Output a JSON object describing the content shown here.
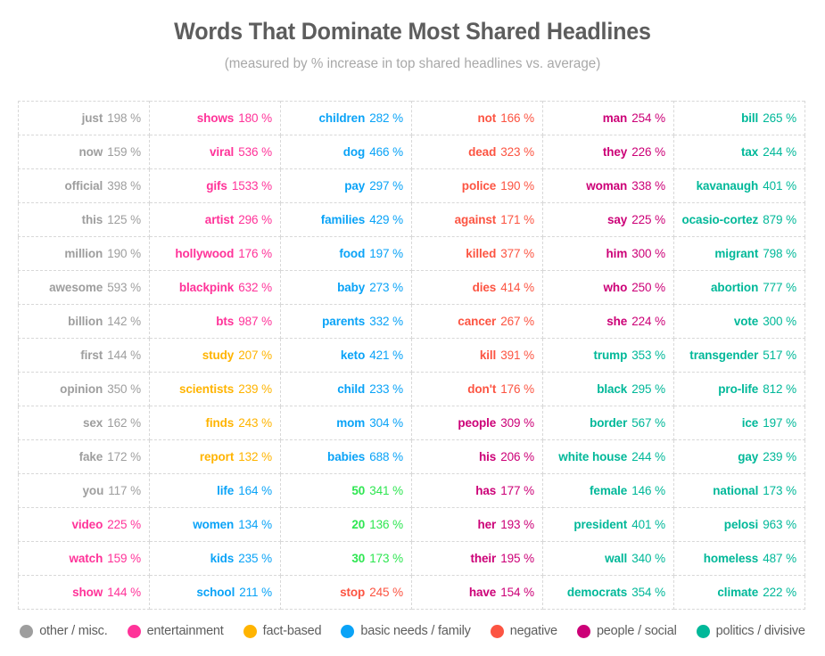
{
  "header": {
    "title": "Words That Dominate Most Shared Headlines",
    "subtitle": "(measured by % increase in top shared headlines vs. average)"
  },
  "unit_suffix": "%",
  "colors": {
    "other": "#9e9e9e",
    "entertainment": "#ff3399",
    "fact_based": "#ffb400",
    "basic_needs": "#0aa3f7",
    "negative": "#fc5442",
    "people_social": "#cc0077",
    "politics": "#00b899",
    "numbers": "#2ee651",
    "title": "#5d5d5d",
    "subtitle": "#a8a8a8",
    "grid_line": "#d8d8d8"
  },
  "legend": {
    "items": [
      {
        "label": "other / misc.",
        "color": "#9e9e9e",
        "key": "other"
      },
      {
        "label": "entertainment",
        "color": "#ff3399",
        "key": "entertainment"
      },
      {
        "label": "fact-based",
        "color": "#ffb400",
        "key": "fact_based"
      },
      {
        "label": "basic needs / family",
        "color": "#0aa3f7",
        "key": "basic_needs"
      },
      {
        "label": "negative",
        "color": "#fc5442",
        "key": "negative"
      },
      {
        "label": "people / social",
        "color": "#cc0077",
        "key": "people_social"
      },
      {
        "label": "politics / divisive",
        "color": "#00b899",
        "key": "politics"
      }
    ]
  },
  "chart_data": {
    "type": "table",
    "title": "Words That Dominate Most Shared Headlines",
    "subtitle": "(measured by % increase in top shared headlines vs. average)",
    "value_unit": "%",
    "columns": 6,
    "rows": 15,
    "grid": [
      [
        {
          "word": "just",
          "value": 198,
          "color": "#9e9e9e"
        },
        {
          "word": "shows",
          "value": 180,
          "color": "#ff3399"
        },
        {
          "word": "children",
          "value": 282,
          "color": "#0aa3f7"
        },
        {
          "word": "not",
          "value": 166,
          "color": "#fc5442"
        },
        {
          "word": "man",
          "value": 254,
          "color": "#cc0077"
        },
        {
          "word": "bill",
          "value": 265,
          "color": "#00b899"
        }
      ],
      [
        {
          "word": "now",
          "value": 159,
          "color": "#9e9e9e"
        },
        {
          "word": "viral",
          "value": 536,
          "color": "#ff3399"
        },
        {
          "word": "dog",
          "value": 466,
          "color": "#0aa3f7"
        },
        {
          "word": "dead",
          "value": 323,
          "color": "#fc5442"
        },
        {
          "word": "they",
          "value": 226,
          "color": "#cc0077"
        },
        {
          "word": "tax",
          "value": 244,
          "color": "#00b899"
        }
      ],
      [
        {
          "word": "official",
          "value": 398,
          "color": "#9e9e9e"
        },
        {
          "word": "gifs",
          "value": 1533,
          "color": "#ff3399"
        },
        {
          "word": "pay",
          "value": 297,
          "color": "#0aa3f7"
        },
        {
          "word": "police",
          "value": 190,
          "color": "#fc5442"
        },
        {
          "word": "woman",
          "value": 338,
          "color": "#cc0077"
        },
        {
          "word": "kavanaugh",
          "value": 401,
          "color": "#00b899"
        }
      ],
      [
        {
          "word": "this",
          "value": 125,
          "color": "#9e9e9e"
        },
        {
          "word": "artist",
          "value": 296,
          "color": "#ff3399"
        },
        {
          "word": "families",
          "value": 429,
          "color": "#0aa3f7"
        },
        {
          "word": "against",
          "value": 171,
          "color": "#fc5442"
        },
        {
          "word": "say",
          "value": 225,
          "color": "#cc0077"
        },
        {
          "word": "ocasio-cortez",
          "value": 879,
          "color": "#00b899"
        }
      ],
      [
        {
          "word": "million",
          "value": 190,
          "color": "#9e9e9e"
        },
        {
          "word": "hollywood",
          "value": 176,
          "color": "#ff3399"
        },
        {
          "word": "food",
          "value": 197,
          "color": "#0aa3f7"
        },
        {
          "word": "killed",
          "value": 377,
          "color": "#fc5442"
        },
        {
          "word": "him",
          "value": 300,
          "color": "#cc0077"
        },
        {
          "word": "migrant",
          "value": 798,
          "color": "#00b899"
        }
      ],
      [
        {
          "word": "awesome",
          "value": 593,
          "color": "#9e9e9e"
        },
        {
          "word": "blackpink",
          "value": 632,
          "color": "#ff3399"
        },
        {
          "word": "baby",
          "value": 273,
          "color": "#0aa3f7"
        },
        {
          "word": "dies",
          "value": 414,
          "color": "#fc5442"
        },
        {
          "word": "who",
          "value": 250,
          "color": "#cc0077"
        },
        {
          "word": "abortion",
          "value": 777,
          "color": "#00b899"
        }
      ],
      [
        {
          "word": "billion",
          "value": 142,
          "color": "#9e9e9e"
        },
        {
          "word": "bts",
          "value": 987,
          "color": "#ff3399"
        },
        {
          "word": "parents",
          "value": 332,
          "color": "#0aa3f7"
        },
        {
          "word": "cancer",
          "value": 267,
          "color": "#fc5442"
        },
        {
          "word": "she",
          "value": 224,
          "color": "#cc0077"
        },
        {
          "word": "vote",
          "value": 300,
          "color": "#00b899"
        }
      ],
      [
        {
          "word": "first",
          "value": 144,
          "color": "#9e9e9e"
        },
        {
          "word": "study",
          "value": 207,
          "color": "#ffb400"
        },
        {
          "word": "keto",
          "value": 421,
          "color": "#0aa3f7"
        },
        {
          "word": "kill",
          "value": 391,
          "color": "#fc5442"
        },
        {
          "word": "trump",
          "value": 353,
          "color": "#00b899"
        },
        {
          "word": "transgender",
          "value": 517,
          "color": "#00b899"
        }
      ],
      [
        {
          "word": "opinion",
          "value": 350,
          "color": "#9e9e9e"
        },
        {
          "word": "scientists",
          "value": 239,
          "color": "#ffb400"
        },
        {
          "word": "child",
          "value": 233,
          "color": "#0aa3f7"
        },
        {
          "word": "don't",
          "value": 176,
          "color": "#fc5442"
        },
        {
          "word": "black",
          "value": 295,
          "color": "#00b899"
        },
        {
          "word": "pro-life",
          "value": 812,
          "color": "#00b899"
        }
      ],
      [
        {
          "word": "sex",
          "value": 162,
          "color": "#9e9e9e"
        },
        {
          "word": "finds",
          "value": 243,
          "color": "#ffb400"
        },
        {
          "word": "mom",
          "value": 304,
          "color": "#0aa3f7"
        },
        {
          "word": "people",
          "value": 309,
          "color": "#cc0077"
        },
        {
          "word": "border",
          "value": 567,
          "color": "#00b899"
        },
        {
          "word": "ice",
          "value": 197,
          "color": "#00b899"
        }
      ],
      [
        {
          "word": "fake",
          "value": 172,
          "color": "#9e9e9e"
        },
        {
          "word": "report",
          "value": 132,
          "color": "#ffb400"
        },
        {
          "word": "babies",
          "value": 688,
          "color": "#0aa3f7"
        },
        {
          "word": "his",
          "value": 206,
          "color": "#cc0077"
        },
        {
          "word": "white house",
          "value": 244,
          "color": "#00b899"
        },
        {
          "word": "gay",
          "value": 239,
          "color": "#00b899"
        }
      ],
      [
        {
          "word": "you",
          "value": 117,
          "color": "#9e9e9e"
        },
        {
          "word": "life",
          "value": 164,
          "color": "#0aa3f7"
        },
        {
          "word": "50",
          "value": 341,
          "color": "#2ee651"
        },
        {
          "word": "has",
          "value": 177,
          "color": "#cc0077"
        },
        {
          "word": "female",
          "value": 146,
          "color": "#00b899"
        },
        {
          "word": "national",
          "value": 173,
          "color": "#00b899"
        }
      ],
      [
        {
          "word": "video",
          "value": 225,
          "color": "#ff3399"
        },
        {
          "word": "women",
          "value": 134,
          "color": "#0aa3f7"
        },
        {
          "word": "20",
          "value": 136,
          "color": "#2ee651"
        },
        {
          "word": "her",
          "value": 193,
          "color": "#cc0077"
        },
        {
          "word": "president",
          "value": 401,
          "color": "#00b899"
        },
        {
          "word": "pelosi",
          "value": 963,
          "color": "#00b899"
        }
      ],
      [
        {
          "word": "watch",
          "value": 159,
          "color": "#ff3399"
        },
        {
          "word": "kids",
          "value": 235,
          "color": "#0aa3f7"
        },
        {
          "word": "30",
          "value": 173,
          "color": "#2ee651"
        },
        {
          "word": "their",
          "value": 195,
          "color": "#cc0077"
        },
        {
          "word": "wall",
          "value": 340,
          "color": "#00b899"
        },
        {
          "word": "homeless",
          "value": 487,
          "color": "#00b899"
        }
      ],
      [
        {
          "word": "show",
          "value": 144,
          "color": "#ff3399"
        },
        {
          "word": "school",
          "value": 211,
          "color": "#0aa3f7"
        },
        {
          "word": "stop",
          "value": 245,
          "color": "#fc5442"
        },
        {
          "word": "have",
          "value": 154,
          "color": "#cc0077"
        },
        {
          "word": "democrats",
          "value": 354,
          "color": "#00b899"
        },
        {
          "word": "climate",
          "value": 222,
          "color": "#00b899"
        }
      ]
    ]
  }
}
